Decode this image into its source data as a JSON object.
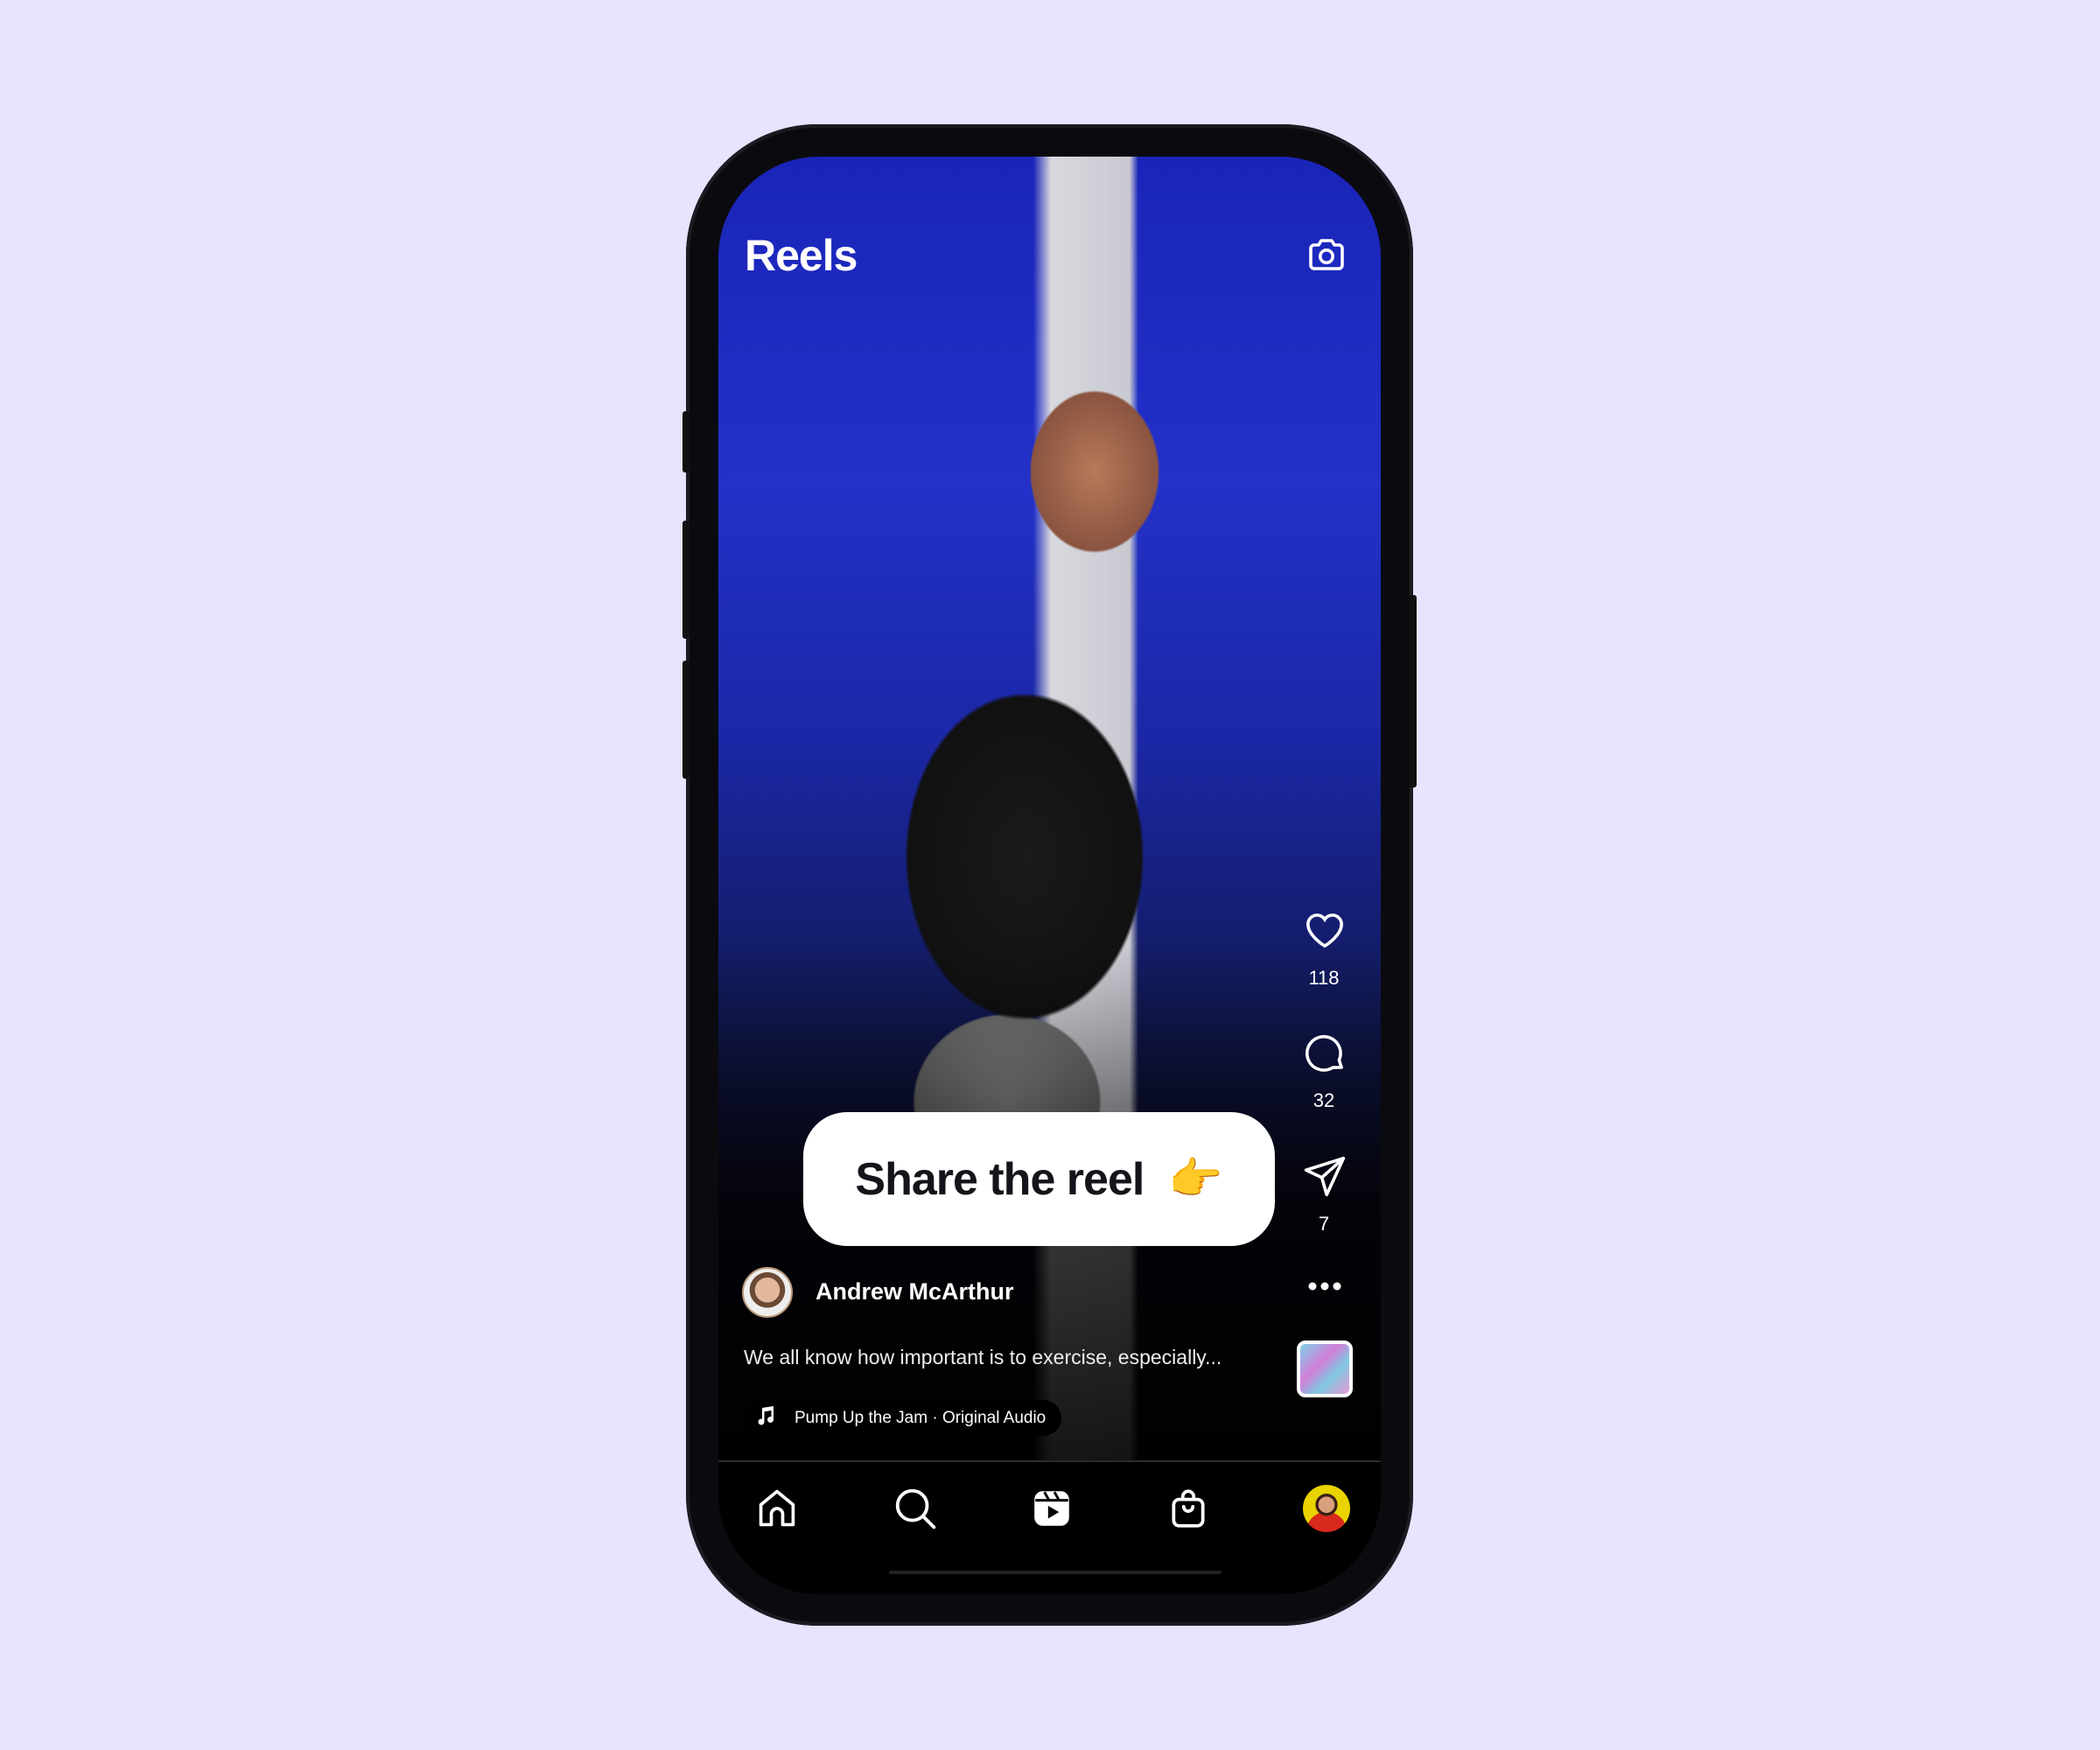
{
  "header": {
    "title": "Reels",
    "camera_icon": "camera-icon"
  },
  "actions": {
    "likes": "118",
    "comments": "32",
    "shares": "7"
  },
  "tooltip": {
    "text": "Share the reel",
    "emoji": "👉"
  },
  "post": {
    "author": "Andrew McArthur",
    "caption": "We all know how important is to exercise, especially...",
    "audio": "Pump Up the Jam · Original Audio"
  },
  "nav": [
    "home",
    "search",
    "reels",
    "shop",
    "profile"
  ],
  "colors": {
    "background": "#e8e3fe",
    "screen": "#000000",
    "tooltip": "#ffffff"
  }
}
